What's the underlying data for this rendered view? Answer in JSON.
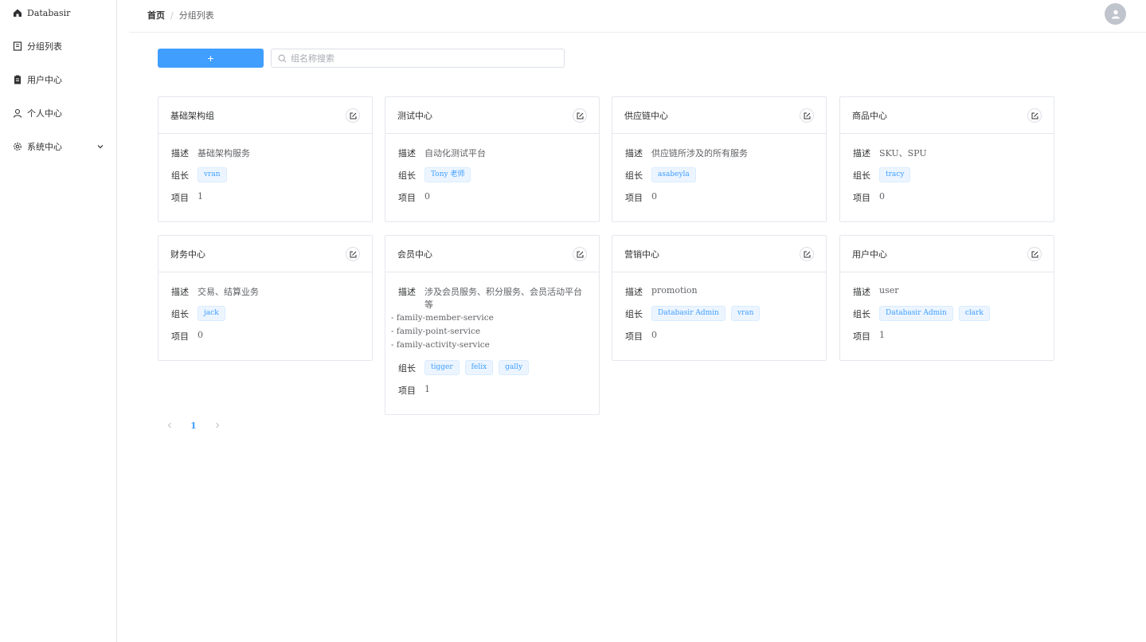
{
  "sidebar": {
    "items": [
      {
        "label": "Databasir",
        "icon": "home-icon"
      },
      {
        "label": "分组列表",
        "icon": "notebook-icon"
      },
      {
        "label": "用户中心",
        "icon": "clipboard-icon"
      },
      {
        "label": "个人中心",
        "icon": "user-icon"
      },
      {
        "label": "系统中心",
        "icon": "gear-icon"
      }
    ]
  },
  "header": {
    "breadcrumb": {
      "home": "首页",
      "separator": "/",
      "current": "分组列表"
    }
  },
  "toolbar": {
    "add_label": "+",
    "search_placeholder": "组名称搜索"
  },
  "labels": {
    "desc": "描述",
    "leader": "组长",
    "project": "项目"
  },
  "cards": [
    {
      "title": "基础架构组",
      "desc": "基础架构服务",
      "desc_extra": "",
      "leaders": [
        "vran"
      ],
      "projects": "1"
    },
    {
      "title": "测试中心",
      "desc": "自动化测试平台",
      "desc_extra": "",
      "leaders": [
        "Tony 老师"
      ],
      "projects": "0"
    },
    {
      "title": "供应链中心",
      "desc": "供应链所涉及的所有服务",
      "desc_extra": "",
      "leaders": [
        "asabeyla"
      ],
      "projects": "0"
    },
    {
      "title": "商品中心",
      "desc": "SKU、SPU",
      "desc_extra": "",
      "leaders": [
        "tracy"
      ],
      "projects": "0"
    },
    {
      "title": "财务中心",
      "desc": "交易、结算业务",
      "desc_extra": "",
      "leaders": [
        "jack"
      ],
      "projects": "0"
    },
    {
      "title": "会员中心",
      "desc": "涉及会员服务、积分服务、会员活动平台等",
      "desc_extra": "- family-member-service\n- family-point-service\n- family-activity-service",
      "leaders": [
        "tigger",
        "felix",
        "gally"
      ],
      "projects": "1"
    },
    {
      "title": "营销中心",
      "desc": "promotion",
      "desc_extra": "",
      "leaders": [
        "Databasir Admin",
        "vran"
      ],
      "projects": "0"
    },
    {
      "title": "用户中心",
      "desc": "user",
      "desc_extra": "",
      "leaders": [
        "Databasir Admin",
        "clark"
      ],
      "projects": "1"
    }
  ],
  "pagination": {
    "current": "1"
  },
  "colors": {
    "primary": "#409eff",
    "border": "#e4e7ed",
    "tag_bg": "#ecf5ff"
  }
}
